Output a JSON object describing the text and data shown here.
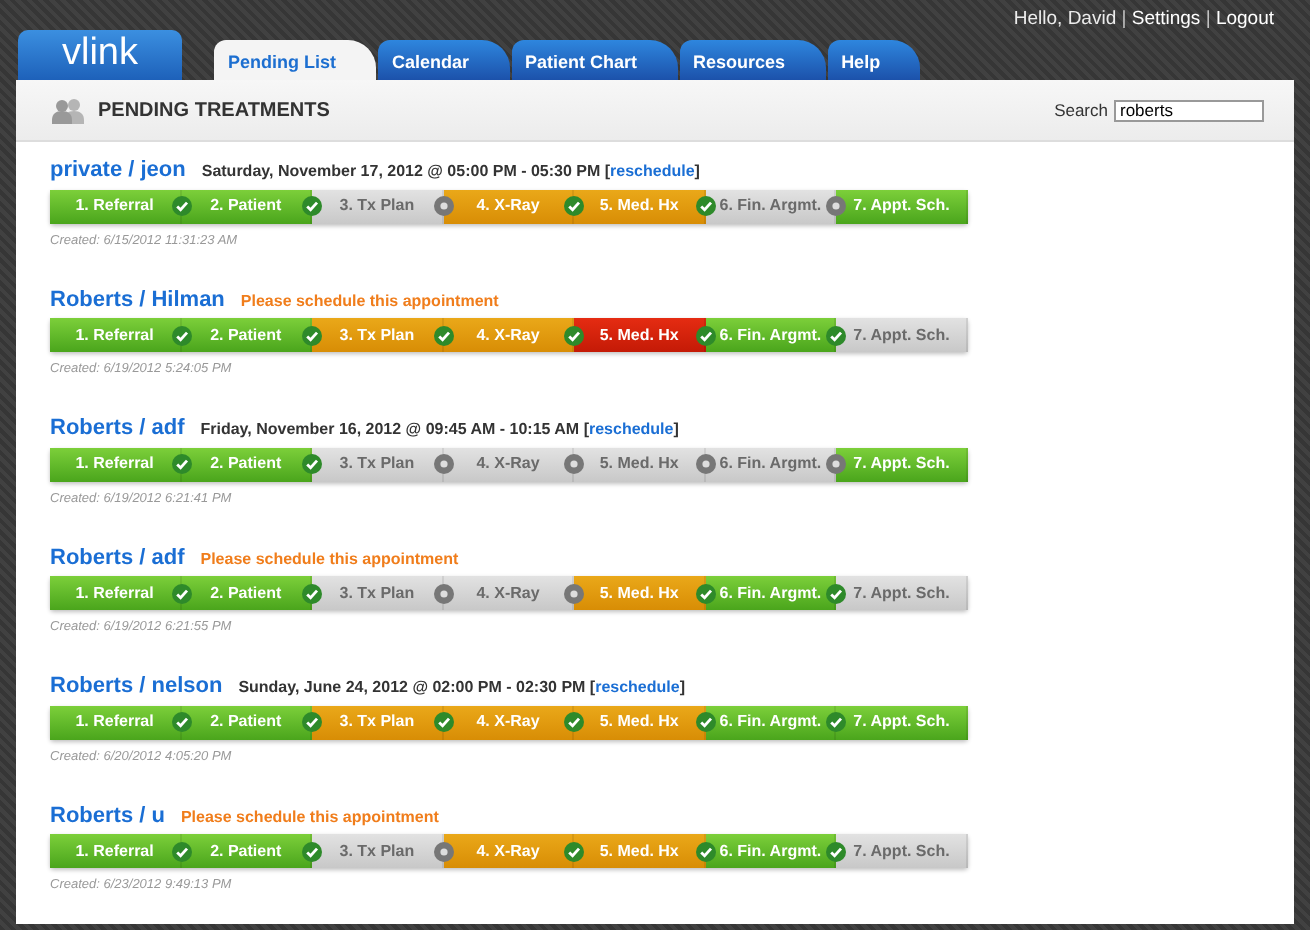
{
  "header": {
    "logo": "vlink",
    "user_menu": [
      {
        "kind": "text",
        "text": "Hello, David"
      },
      {
        "kind": "sep",
        "text": "|"
      },
      {
        "kind": "link",
        "text": "Settings"
      },
      {
        "kind": "sep",
        "text": "|"
      },
      {
        "kind": "link",
        "text": "Logout"
      }
    ]
  },
  "tabs": [
    {
      "label": "Pending List",
      "selected": true
    },
    {
      "label": "Calendar",
      "selected": false
    },
    {
      "label": "Patient Chart",
      "selected": false
    },
    {
      "label": "Resources",
      "selected": false
    },
    {
      "label": "Help",
      "selected": false
    }
  ],
  "panel": {
    "title": "PENDING TREATMENTS",
    "search": {
      "label": "Search",
      "value": "roberts"
    }
  },
  "treatments": [
    {
      "patient": "private / jeon",
      "kind": "scheduled",
      "appointment": "Saturday, November 17, 2012 @ 05:00 PM - 05:30 PM",
      "action": {
        "before": "[",
        "label": "reschedule",
        "after": "]"
      },
      "steps": [
        {
          "label": "1. Referral",
          "kind": "done"
        },
        {
          "label": "2. Patient",
          "kind": "done"
        },
        {
          "label": "3. Tx Plan",
          "kind": "pending"
        },
        {
          "label": "4. X-Ray",
          "kind": "progress"
        },
        {
          "label": "5. Med. Hx",
          "kind": "progress"
        },
        {
          "label": "6. Fin. Argmt.",
          "kind": "pending"
        },
        {
          "label": "7. Appt. Sch.",
          "kind": "done"
        }
      ],
      "created": "Created: 6/15/2012 11:31:23 AM"
    },
    {
      "patient": "Roberts / Hilman",
      "kind": "unscheduled",
      "notice": "Please schedule this appointment",
      "steps": [
        {
          "label": "1. Referral",
          "kind": "done"
        },
        {
          "label": "2. Patient",
          "kind": "done"
        },
        {
          "label": "3. Tx Plan",
          "kind": "progress"
        },
        {
          "label": "4. X-Ray",
          "kind": "progress"
        },
        {
          "label": "5. Med. Hx",
          "kind": "alert"
        },
        {
          "label": "6. Fin. Argmt.",
          "kind": "done"
        },
        {
          "label": "7. Appt. Sch.",
          "kind": "pending"
        }
      ],
      "created": "Created: 6/19/2012 5:24:05 PM"
    },
    {
      "patient": "Roberts / adf",
      "kind": "scheduled",
      "appointment": "Friday, November 16, 2012 @ 09:45 AM - 10:15 AM",
      "action": {
        "before": "[",
        "label": "reschedule",
        "after": "]"
      },
      "steps": [
        {
          "label": "1. Referral",
          "kind": "done"
        },
        {
          "label": "2. Patient",
          "kind": "done"
        },
        {
          "label": "3. Tx Plan",
          "kind": "pending"
        },
        {
          "label": "4. X-Ray",
          "kind": "pending"
        },
        {
          "label": "5. Med. Hx",
          "kind": "pending"
        },
        {
          "label": "6. Fin. Argmt.",
          "kind": "pending"
        },
        {
          "label": "7. Appt. Sch.",
          "kind": "done"
        }
      ],
      "created": "Created: 6/19/2012 6:21:41 PM"
    },
    {
      "patient": "Roberts / adf",
      "kind": "unscheduled",
      "notice": "Please schedule this appointment",
      "steps": [
        {
          "label": "1. Referral",
          "kind": "done"
        },
        {
          "label": "2. Patient",
          "kind": "done"
        },
        {
          "label": "3. Tx Plan",
          "kind": "pending"
        },
        {
          "label": "4. X-Ray",
          "kind": "pending"
        },
        {
          "label": "5. Med. Hx",
          "kind": "progress"
        },
        {
          "label": "6. Fin. Argmt.",
          "kind": "done"
        },
        {
          "label": "7. Appt. Sch.",
          "kind": "pending"
        }
      ],
      "created": "Created: 6/19/2012 6:21:55 PM"
    },
    {
      "patient": "Roberts / nelson",
      "kind": "scheduled",
      "appointment": "Sunday, June 24, 2012 @ 02:00 PM - 02:30 PM",
      "action": {
        "before": "[",
        "label": "reschedule",
        "after": "]"
      },
      "steps": [
        {
          "label": "1. Referral",
          "kind": "done"
        },
        {
          "label": "2. Patient",
          "kind": "done"
        },
        {
          "label": "3. Tx Plan",
          "kind": "progress"
        },
        {
          "label": "4. X-Ray",
          "kind": "progress"
        },
        {
          "label": "5. Med. Hx",
          "kind": "progress"
        },
        {
          "label": "6. Fin. Argmt.",
          "kind": "done"
        },
        {
          "label": "7. Appt. Sch.",
          "kind": "done"
        }
      ],
      "created": "Created: 6/20/2012 4:05:20 PM"
    },
    {
      "patient": "Roberts / u",
      "kind": "unscheduled",
      "notice": "Please schedule this appointment",
      "steps": [
        {
          "label": "1. Referral",
          "kind": "done"
        },
        {
          "label": "2. Patient",
          "kind": "done"
        },
        {
          "label": "3. Tx Plan",
          "kind": "pending"
        },
        {
          "label": "4. X-Ray",
          "kind": "progress"
        },
        {
          "label": "5. Med. Hx",
          "kind": "progress"
        },
        {
          "label": "6. Fin. Argmt.",
          "kind": "done"
        },
        {
          "label": "7. Appt. Sch.",
          "kind": "pending"
        }
      ],
      "created": "Created: 6/23/2012 9:49:13 PM"
    }
  ]
}
